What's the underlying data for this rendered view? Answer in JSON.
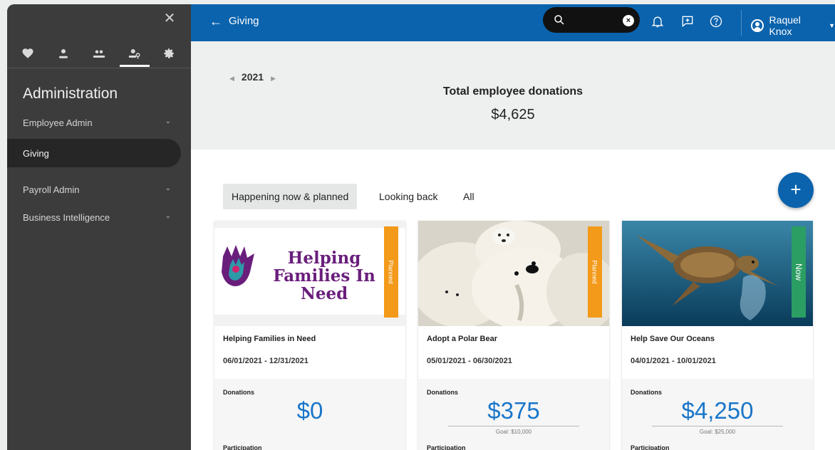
{
  "sidebar": {
    "close_icon": "close-icon",
    "icons": [
      "heart-icon",
      "person-icon",
      "people-icon",
      "admin-person-icon",
      "gear-icon"
    ],
    "title": "Administration",
    "items": [
      {
        "label": "Employee Admin",
        "chevron": "chevron-down-icon"
      },
      {
        "label": "Giving"
      },
      {
        "label": "Payroll Admin",
        "chevron": "chevron-down-icon"
      },
      {
        "label": "Business Intelligence",
        "chevron": "chevron-down-icon"
      }
    ]
  },
  "topbar": {
    "title": "Giving",
    "back_icon": "back-arrow-icon",
    "search": {
      "value": "",
      "icon": "search-icon",
      "clear_icon": "clear-icon"
    },
    "icons": [
      "bell-icon",
      "feedback-icon",
      "help-icon"
    ],
    "user": {
      "name": "Raquel Knox"
    }
  },
  "summary": {
    "year": "2021",
    "total_label": "Total employee donations",
    "total_value": "$4,625"
  },
  "tabs": [
    {
      "label": "Happening now & planned",
      "active": true
    },
    {
      "label": "Looking back",
      "active": false
    },
    {
      "label": "All",
      "active": false
    }
  ],
  "add_button_label": "+",
  "cards": [
    {
      "image_text": "Helping Families In Need",
      "badge": "Planned",
      "badge_color": "#f39a1a",
      "name": "Helping Families in Need",
      "dates": "06/01/2021 - 12/31/2021",
      "donations_label": "Donations",
      "donations": "$0",
      "goal": "",
      "participation_label": "Participation"
    },
    {
      "badge": "Planned",
      "badge_color": "#f39a1a",
      "name": "Adopt a Polar Bear",
      "dates": "05/01/2021 - 06/30/2021",
      "donations_label": "Donations",
      "donations": "$375",
      "goal": "Goal: $10,000",
      "participation_label": "Participation"
    },
    {
      "badge": "Now",
      "badge_color": "#2b9e63",
      "name": "Help Save Our Oceans",
      "dates": "04/01/2021 - 10/01/2021",
      "donations_label": "Donations",
      "donations": "$4,250",
      "goal": "Goal: $25,000",
      "participation_label": "Participation"
    }
  ]
}
